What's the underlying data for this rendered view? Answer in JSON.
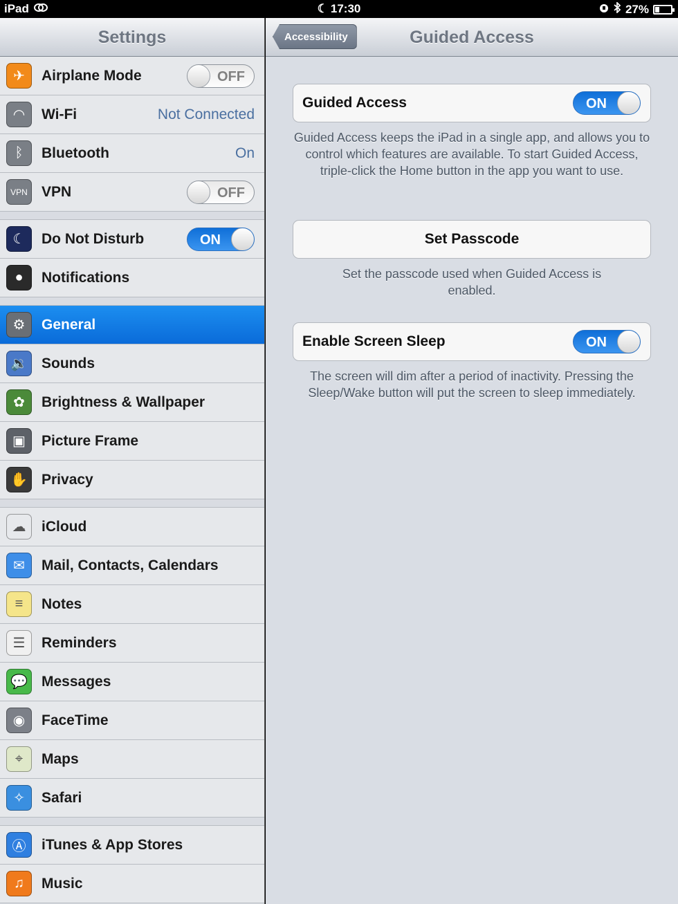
{
  "status_bar": {
    "device": "iPad",
    "time": "17:30",
    "battery": "27%",
    "battery_level": 0.27
  },
  "sidebar": {
    "title": "Settings",
    "groups": [
      [
        {
          "label": "Airplane Mode",
          "icon": "airplane-icon",
          "color": "#f28a1a",
          "control": "toggle",
          "state": "OFF"
        },
        {
          "label": "Wi-Fi",
          "icon": "wifi-icon",
          "color": "#7a7f86",
          "control": "value",
          "value": "Not Connected"
        },
        {
          "label": "Bluetooth",
          "icon": "bluetooth-icon",
          "color": "#7a7f86",
          "control": "value",
          "value": "On"
        },
        {
          "label": "VPN",
          "icon": "vpn-icon",
          "color": "#7a7f86",
          "control": "toggle",
          "state": "OFF"
        }
      ],
      [
        {
          "label": "Do Not Disturb",
          "icon": "moon-icon",
          "color": "#1d2a5c",
          "control": "toggle",
          "state": "ON"
        },
        {
          "label": "Notifications",
          "icon": "notifications-icon",
          "color": "#2a2a2a",
          "control": "none"
        }
      ],
      [
        {
          "label": "General",
          "icon": "gear-icon",
          "color": "#6a6f76",
          "control": "none",
          "selected": true
        },
        {
          "label": "Sounds",
          "icon": "speaker-icon",
          "color": "#4a79c8",
          "control": "none"
        },
        {
          "label": "Brightness & Wallpaper",
          "icon": "flower-icon",
          "color": "#4b8a3a",
          "control": "none"
        },
        {
          "label": "Picture Frame",
          "icon": "picture-frame-icon",
          "color": "#5d6168",
          "control": "none"
        },
        {
          "label": "Privacy",
          "icon": "hand-icon",
          "color": "#3a3a3a",
          "control": "none"
        }
      ],
      [
        {
          "label": "iCloud",
          "icon": "cloud-icon",
          "color": "#e7e9ec",
          "control": "none"
        },
        {
          "label": "Mail, Contacts, Calendars",
          "icon": "mail-icon",
          "color": "#3e8ee8",
          "control": "none"
        },
        {
          "label": "Notes",
          "icon": "notes-icon",
          "color": "#f5e58a",
          "control": "none"
        },
        {
          "label": "Reminders",
          "icon": "reminders-icon",
          "color": "#f0f0f0",
          "control": "none"
        },
        {
          "label": "Messages",
          "icon": "messages-icon",
          "color": "#48b94a",
          "control": "none"
        },
        {
          "label": "FaceTime",
          "icon": "facetime-icon",
          "color": "#7c8088",
          "control": "none"
        },
        {
          "label": "Maps",
          "icon": "maps-icon",
          "color": "#dfe8c9",
          "control": "none"
        },
        {
          "label": "Safari",
          "icon": "safari-icon",
          "color": "#3a8fe0",
          "control": "none"
        }
      ],
      [
        {
          "label": "iTunes & App Stores",
          "icon": "app-store-icon",
          "color": "#2f7fe0",
          "control": "none"
        },
        {
          "label": "Music",
          "icon": "music-icon",
          "color": "#f07a1c",
          "control": "none"
        }
      ]
    ]
  },
  "detail": {
    "back_label": "Accessibility",
    "title": "Guided Access",
    "guided_access": {
      "label": "Guided Access",
      "state": "ON"
    },
    "guided_access_note": "Guided Access keeps the iPad in a single app, and allows you to control which features are available. To start Guided Access, triple-click the Home button in the app you want to use.",
    "passcode": {
      "label": "Set Passcode"
    },
    "passcode_note": "Set the passcode used when Guided Access is enabled.",
    "screen_sleep": {
      "label": "Enable Screen Sleep",
      "state": "ON"
    },
    "screen_sleep_note": "The screen will dim after a period of inactivity. Pressing the Sleep/Wake button will put the screen to sleep immediately."
  }
}
